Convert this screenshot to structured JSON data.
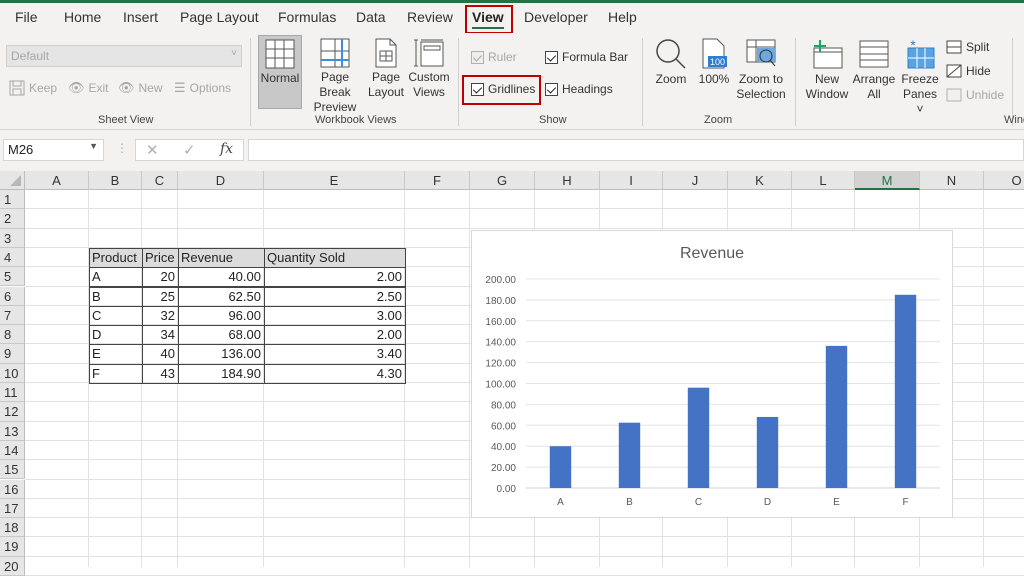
{
  "menu": {
    "items": [
      "File",
      "Home",
      "Insert",
      "Page Layout",
      "Formulas",
      "Data",
      "Review",
      "View",
      "Developer",
      "Help"
    ],
    "active": "View"
  },
  "ribbon": {
    "sheet_view": {
      "dropdown_value": "Default",
      "keep": "Keep",
      "exit": "Exit",
      "new": "New",
      "options": "Options",
      "label": "Sheet View"
    },
    "workbook_views": {
      "normal": "Normal",
      "page_break_1": "Page Break",
      "page_break_2": "Preview",
      "page_layout_1": "Page",
      "page_layout_2": "Layout",
      "custom_1": "Custom",
      "custom_2": "Views",
      "label": "Workbook Views"
    },
    "show": {
      "ruler": "Ruler",
      "formula_bar": "Formula Bar",
      "gridlines": "Gridlines",
      "headings": "Headings",
      "label": "Show",
      "ruler_checked": true,
      "formula_bar_checked": true,
      "gridlines_checked": true,
      "headings_checked": true
    },
    "zoom": {
      "zoom": "Zoom",
      "hundred": "100%",
      "hundred_icon_text": "100",
      "zoom_sel_1": "Zoom to",
      "zoom_sel_2": "Selection",
      "label": "Zoom"
    },
    "window": {
      "new_1": "New",
      "new_2": "Window",
      "arrange_1": "Arrange",
      "arrange_2": "All",
      "freeze_1": "Freeze",
      "freeze_2": "Panes ˅",
      "split": "Split",
      "hide": "Hide",
      "unhide": "Unhide",
      "label": "Wind"
    }
  },
  "formula_bar": {
    "name_box": "M26",
    "cancel": "✕",
    "enter": "✓",
    "fx": "fx",
    "value": ""
  },
  "columns": [
    "A",
    "B",
    "C",
    "D",
    "E",
    "F",
    "G",
    "H",
    "I",
    "J",
    "K",
    "L",
    "M",
    "N",
    "O"
  ],
  "selected_column": "M",
  "rows": [
    "1",
    "2",
    "3",
    "4",
    "5",
    "6",
    "7",
    "8",
    "9",
    "10",
    "11",
    "12",
    "13",
    "14",
    "15",
    "16",
    "17",
    "18",
    "19",
    "20"
  ],
  "table": {
    "headers": [
      "Product",
      "Price",
      "Revenue",
      "Quantity Sold"
    ],
    "rows": [
      [
        "A",
        "20",
        "40.00",
        "2.00"
      ],
      [
        "B",
        "25",
        "62.50",
        "2.50"
      ],
      [
        "C",
        "32",
        "96.00",
        "3.00"
      ],
      [
        "D",
        "34",
        "68.00",
        "2.00"
      ],
      [
        "E",
        "40",
        "136.00",
        "3.40"
      ],
      [
        "F",
        "43",
        "184.90",
        "4.30"
      ]
    ]
  },
  "chart_data": {
    "type": "bar",
    "title": "Revenue",
    "categories": [
      "A",
      "B",
      "C",
      "D",
      "E",
      "F"
    ],
    "values": [
      40.0,
      62.5,
      96.0,
      68.0,
      136.0,
      184.9
    ],
    "xlabel": "",
    "ylabel": "",
    "ylim": [
      0,
      200
    ],
    "yticks": [
      "0.00",
      "20.00",
      "40.00",
      "60.00",
      "80.00",
      "100.00",
      "120.00",
      "140.00",
      "160.00",
      "180.00",
      "200.00"
    ],
    "grid": true,
    "legend": "none",
    "bar_color": "#4472c4"
  }
}
